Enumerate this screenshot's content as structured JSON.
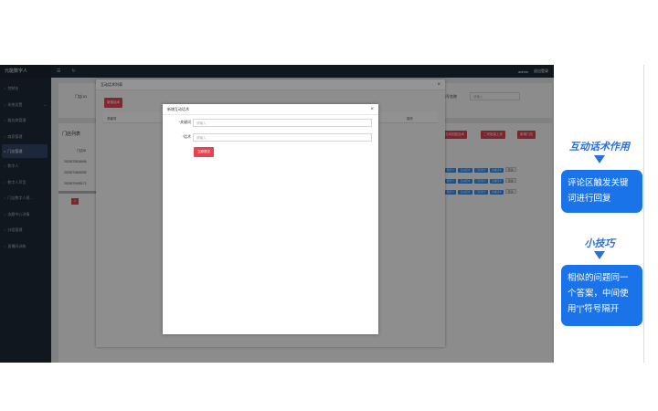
{
  "app": {
    "brand": "元能数字人",
    "user": "admin",
    "logout": "退出登录"
  },
  "sidebar": {
    "items": [
      {
        "label": "控制台"
      },
      {
        "label": "系统设置"
      },
      {
        "label": "服务商管理"
      },
      {
        "label": "商家管理"
      },
      {
        "label": "门店管理"
      },
      {
        "label": "数字人"
      },
      {
        "label": "数字人声音"
      },
      {
        "label": "门店数字人视..."
      },
      {
        "label": "选题中心详情"
      },
      {
        "label": "分组管理"
      },
      {
        "label": "直播间训练"
      }
    ]
  },
  "background": {
    "store_label": "门店 ID",
    "account_label": "账号名称",
    "account_placeholder": "请输入",
    "list_title": "门店列表",
    "col_store_id": "门店ID",
    "col_action": "操作",
    "id_header": "关键词",
    "btn_interact": "互动回复话术",
    "btn_batch": "二号批量上传",
    "btn_add": "新增门店",
    "rows": [
      {
        "id": "2023070816045"
      },
      {
        "id": "2023070808035"
      },
      {
        "id": "2023070408172"
      }
    ],
    "tag_a": "数字人",
    "tag_b": "互动话术",
    "tag_c": "门店账号",
    "tag_d": "直播话术",
    "more": "更多",
    "page": "1"
  },
  "dialog_list": {
    "title": "互动话术列表",
    "add_button": "新增话术"
  },
  "dialog_new": {
    "title": "新增互动话术",
    "keyword_label": "关键词",
    "keyword_placeholder": "请输入",
    "script_label": "话术",
    "script_placeholder": "请输入",
    "required_mark": "*",
    "submit": "立即提交",
    "close": "×"
  },
  "panel": {
    "title1": "互动话术作用",
    "box1": "评论区触发关键词进行回复",
    "title2": "小技巧",
    "box2": "相似的问题同一个答案，中间使用“|”符号隔开"
  },
  "colors": {
    "accent_red": "#e64252",
    "panel_blue": "#1a73e8",
    "sidebar_bg": "#1e2a3a"
  }
}
